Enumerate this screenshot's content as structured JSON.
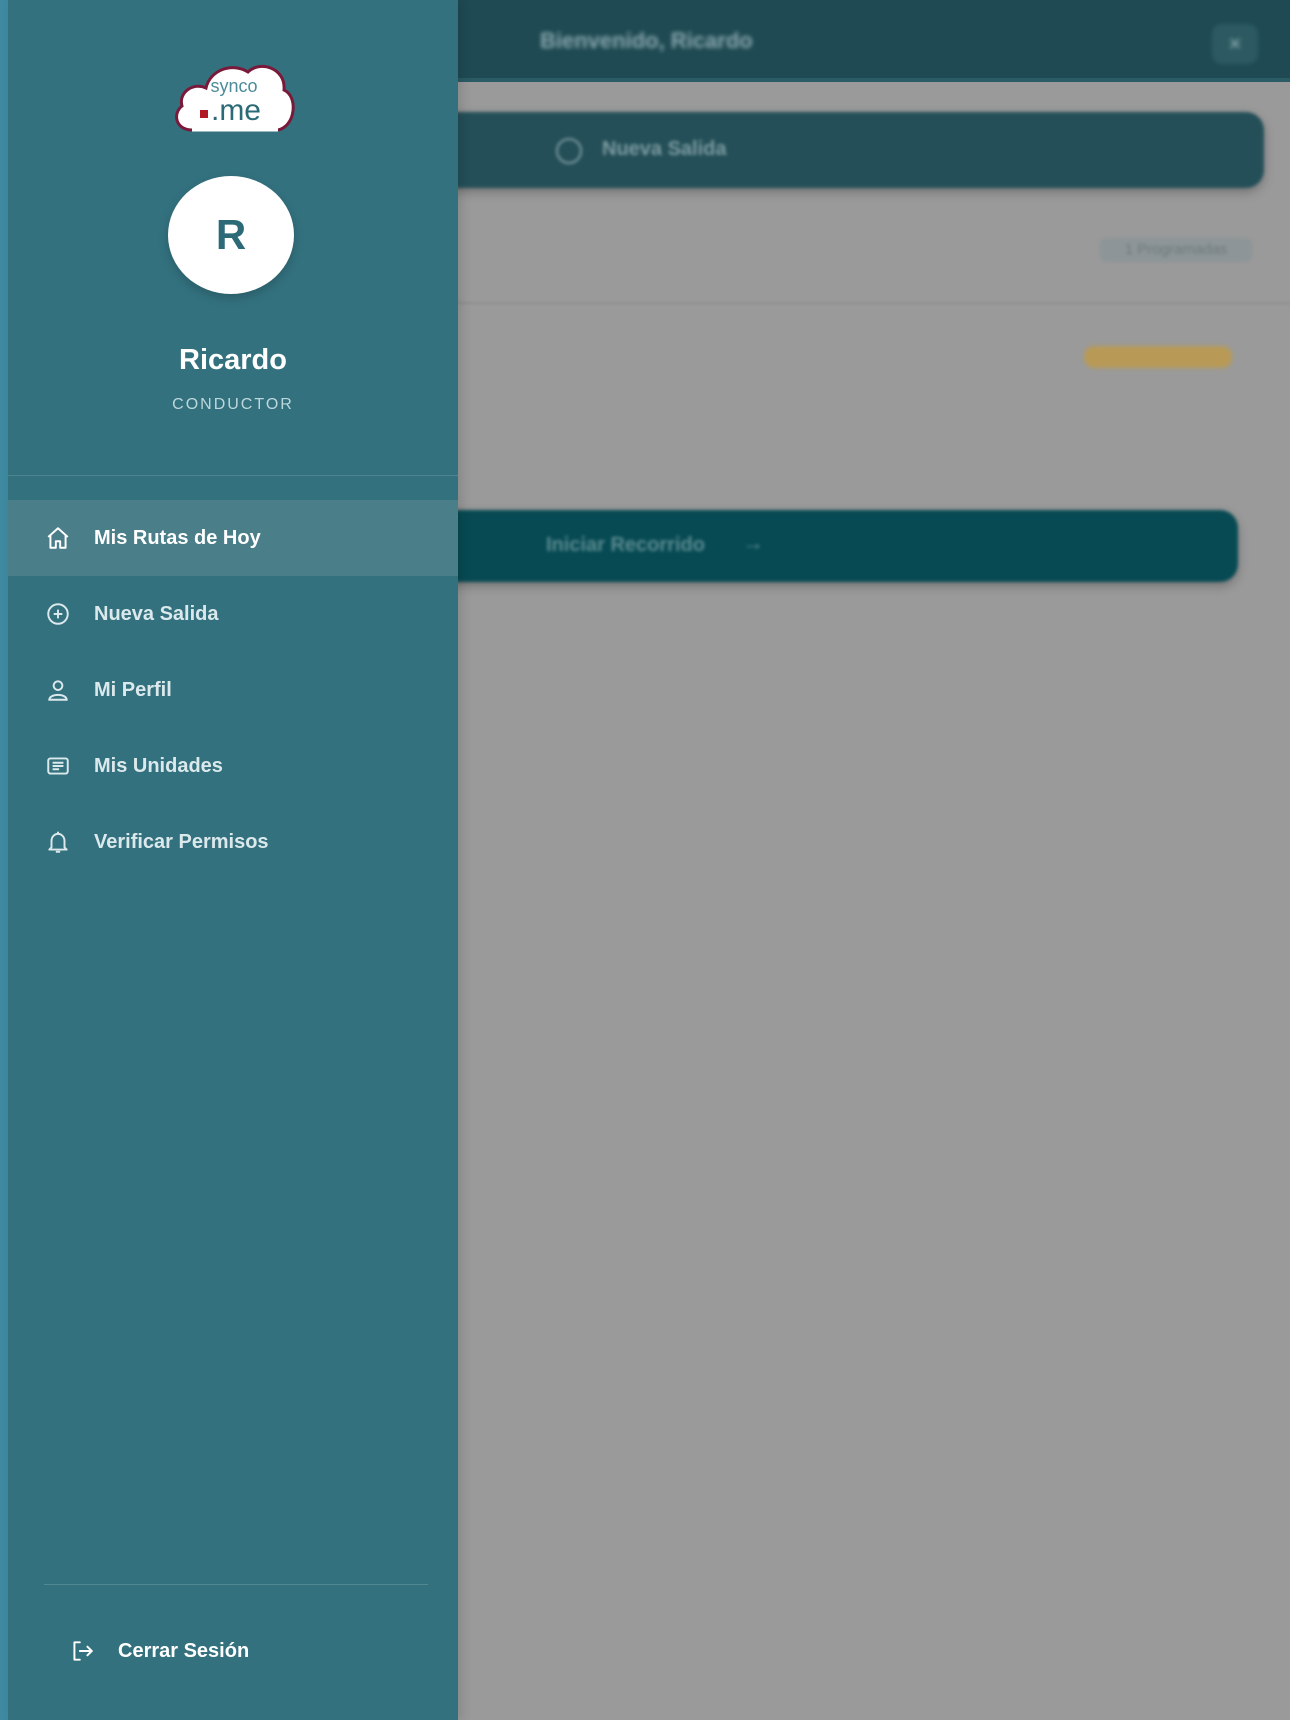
{
  "background_app": {
    "header_title": "Bienvenido, Ricardo",
    "close_symbol": "×",
    "new_exit_label": "Nueva Salida",
    "scheduled_chip": "1 Programadas",
    "start_route_label": "Iniciar Recorrido",
    "start_route_arrow": "→"
  },
  "drawer": {
    "logo": {
      "top_text": "synco",
      "bottom_text": ".me",
      "brand_color": "#7a1a3a"
    },
    "avatar_initial": "R",
    "user_name": "Ricardo",
    "user_role": "CONDUCTOR",
    "nav_items": [
      {
        "label": "Mis Rutas de Hoy",
        "icon": "home-icon",
        "active": true
      },
      {
        "label": "Nueva Salida",
        "icon": "plus-circle-icon",
        "active": false
      },
      {
        "label": "Mi Perfil",
        "icon": "user-icon",
        "active": false
      },
      {
        "label": "Mis Unidades",
        "icon": "card-list-icon",
        "active": false
      },
      {
        "label": "Verificar Permisos",
        "icon": "bell-icon",
        "active": false
      }
    ],
    "logout_label": "Cerrar Sesión"
  },
  "colors": {
    "drawer_bg": "#33717e",
    "active_item_bg": "#4a7e89",
    "header_bg": "#1f4a53",
    "start_button_bg": "#074a53",
    "overlay_gray": "#9a9a9a"
  }
}
